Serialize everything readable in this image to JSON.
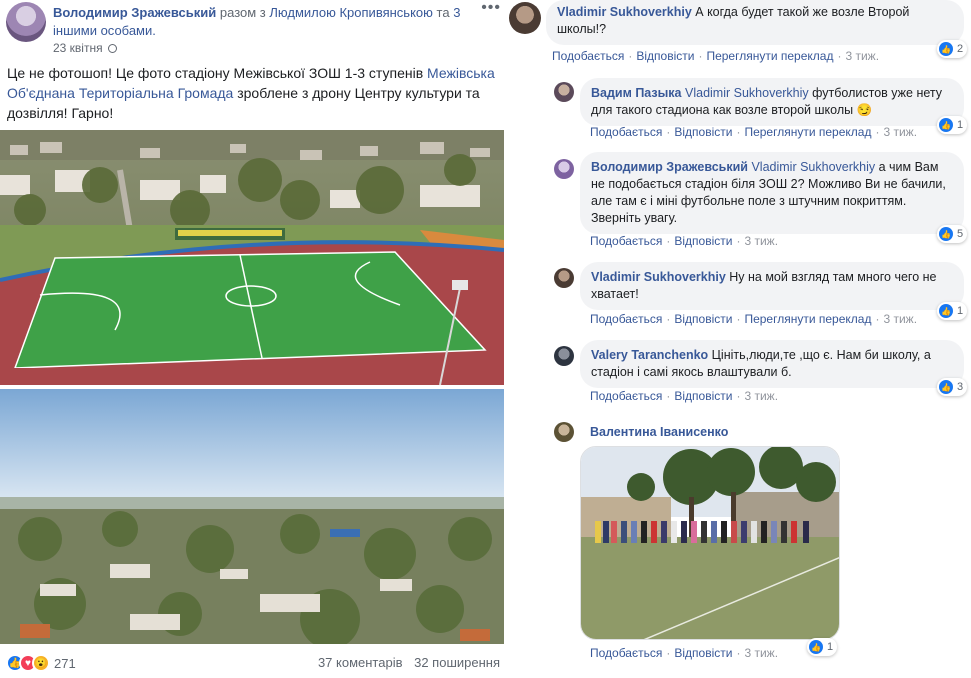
{
  "post": {
    "author": "Володимир Зражевський",
    "with_text": "разом з",
    "tagged_person": "Людмилою Кропивянською",
    "and_text": "та",
    "others": "3 іншими особами.",
    "date": "23 квітня",
    "more_icon": "more-dots-icon",
    "text_part1": "Це не фотошоп! Це фото стадіону Межівської ЗОШ 1-3 ступенів ",
    "text_link": "Межівська Об'єднана Територіальна Громада",
    "text_part2": " зроблене з дрону Центру культури та дозвілля! Гарно!",
    "reaction_count": "271",
    "comments_count": "37 коментарів",
    "shares_count": "32 поширення",
    "colors": {
      "link": "#385898",
      "like": "#1877f2",
      "love": "#f33e58",
      "wow": "#f7b125"
    }
  },
  "actions": {
    "like": "Подобається",
    "reply": "Відповісти",
    "see_translation": "Переглянути переклад"
  },
  "comments": [
    {
      "author": "Vladimir Sukhoverkhiy",
      "tag": "",
      "text": "А когда будет такой же возле Второй школы!?",
      "time": "3 тиж.",
      "likes": "2",
      "translation": true
    },
    {
      "author": "Вадим Пазыка",
      "tag": "Vladimir Sukhoverkhiy",
      "text": "футболистов уже нету для такого стадиона как возле второй школы 😏",
      "time": "3 тиж.",
      "likes": "1",
      "translation": true
    },
    {
      "author": "Володимир Зражевський",
      "tag": "Vladimir Sukhoverkhiy",
      "text": "а чим Вам не подобається стадіон біля ЗОШ 2? Можливо Ви не бачили, але там є і міні футбольне поле з штучним покриттям. Зверніть увагу.",
      "time": "3 тиж.",
      "likes": "5",
      "translation": false
    },
    {
      "author": "Vladimir Sukhoverkhiy",
      "tag": "",
      "text": "Ну на мой взгляд там много чего не хватает!",
      "time": "3 тиж.",
      "likes": "1",
      "translation": true
    },
    {
      "author": "Valery Taranchenko",
      "tag": "",
      "text": "Цініть,люди,те ,що є. Нам би школу, а стадіон і самі якось влаштували б.",
      "time": "3 тиж.",
      "likes": "3",
      "translation": false
    },
    {
      "author": "Валентина Іванисенко",
      "tag": "",
      "text": "",
      "time": "3 тиж.",
      "likes": "1",
      "translation": false
    }
  ]
}
